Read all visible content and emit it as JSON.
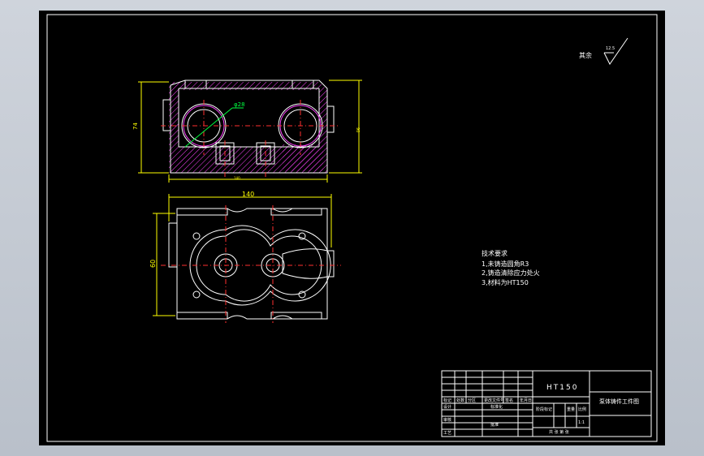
{
  "surface_finish": {
    "label": "其余",
    "value": "12.5"
  },
  "technical_requirements": {
    "title": "技术要求",
    "items": [
      "1,未铸造圆角R3",
      "2,铸造清除应力处火",
      "3,材料为HT150"
    ]
  },
  "dimensions": {
    "top_width": "140",
    "top_height": "74",
    "top_right": "90",
    "bottom_width": "140",
    "bottom_height": "60",
    "bore_diameter": "φ28"
  },
  "title_block": {
    "material": "HT150",
    "part_name": "泵体铸件工件图",
    "row_labels": [
      "标记",
      "设计",
      "审核",
      "工艺"
    ],
    "col_labels": [
      "处数",
      "分区",
      "更改文件号",
      "签名",
      "年月日"
    ],
    "std_label": "标准化",
    "approve_label": "批准",
    "stage_label": "阶段标记",
    "weight_label": "重量",
    "scale_label": "比例",
    "scale_value": "1:1",
    "sheet_label": "共 张 第 张"
  },
  "colors": {
    "background": "#000000",
    "outline": "#ffffff",
    "dimension": "#ffff00",
    "center": "#ff3030",
    "hatch": "#ff44ff",
    "leader": "#00ff40"
  }
}
